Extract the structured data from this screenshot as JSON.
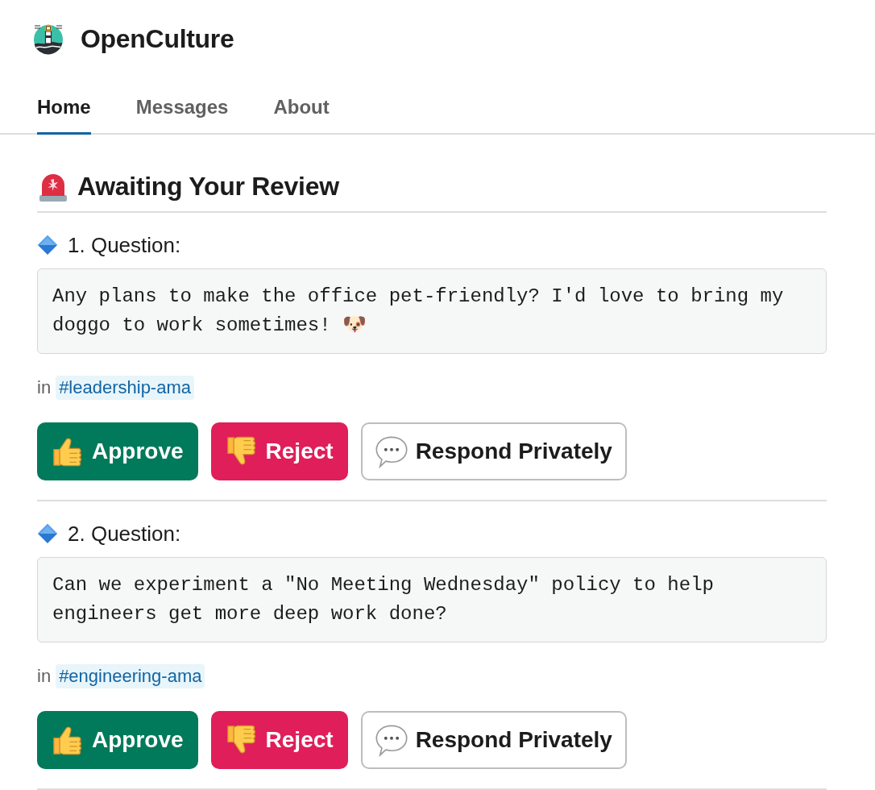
{
  "app": {
    "name": "OpenCulture"
  },
  "tabs": [
    {
      "label": "Home",
      "selected": true
    },
    {
      "label": "Messages",
      "selected": false
    },
    {
      "label": "About",
      "selected": false
    }
  ],
  "section": {
    "title": "Awaiting Your Review"
  },
  "questions": [
    {
      "heading": "1. Question:",
      "text": "Any plans to make the office pet-friendly? I'd love to bring my doggo to work sometimes! 🐶",
      "channel_prefix": "in",
      "channel": "#leadership-ama",
      "actions": [
        {
          "kind": "approve",
          "label": "Approve"
        },
        {
          "kind": "reject",
          "label": "Reject"
        },
        {
          "kind": "respond",
          "label": "Respond Privately"
        }
      ]
    },
    {
      "heading": "2. Question:",
      "text": "Can we experiment a \"No Meeting Wednesday\" policy to help engineers get more deep work done?",
      "channel_prefix": "in",
      "channel": "#engineering-ama",
      "actions": [
        {
          "kind": "approve",
          "label": "Approve"
        },
        {
          "kind": "reject",
          "label": "Reject"
        },
        {
          "kind": "respond",
          "label": "Respond Privately"
        }
      ]
    }
  ]
}
